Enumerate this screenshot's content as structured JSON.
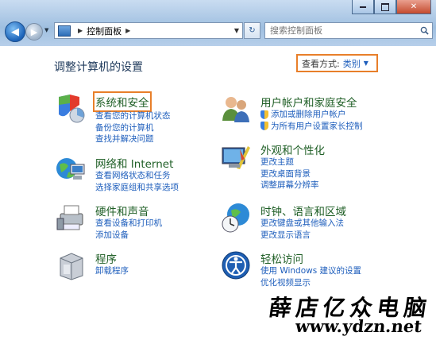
{
  "breadcrumb": {
    "items": [
      "控制面板"
    ]
  },
  "search": {
    "placeholder": "搜索控制面板"
  },
  "page": {
    "title": "调整计算机的设置"
  },
  "view_by": {
    "label": "查看方式:",
    "value": "类别"
  },
  "categories": [
    {
      "title": "系统和安全",
      "links": [
        "查看您的计算机状态",
        "备份您的计算机",
        "查找并解决问题"
      ]
    },
    {
      "title": "网络和 Internet",
      "links": [
        "查看网络状态和任务",
        "选择家庭组和共享选项"
      ]
    },
    {
      "title": "硬件和声音",
      "links": [
        "查看设备和打印机",
        "添加设备"
      ]
    },
    {
      "title": "程序",
      "links": [
        "卸载程序"
      ]
    },
    {
      "title": "用户帐户和家庭安全",
      "links": [
        "添加或删除用户帐户",
        "为所有用户设置家长控制"
      ]
    },
    {
      "title": "外观和个性化",
      "links": [
        "更改主题",
        "更改桌面背景",
        "调整屏幕分辨率"
      ]
    },
    {
      "title": "时钟、语言和区域",
      "links": [
        "更改键盘或其他输入法",
        "更改显示语言"
      ]
    },
    {
      "title": "轻松访问",
      "links": [
        "使用 Windows 建议的设置",
        "优化视频显示"
      ]
    }
  ],
  "watermark": {
    "line1": "薛店亿众电脑",
    "line2": "www.ydzn.net"
  },
  "colors": {
    "accent_highlight": "#e87f2a",
    "link": "#1e5ebc",
    "category_title": "#1f5f26"
  }
}
